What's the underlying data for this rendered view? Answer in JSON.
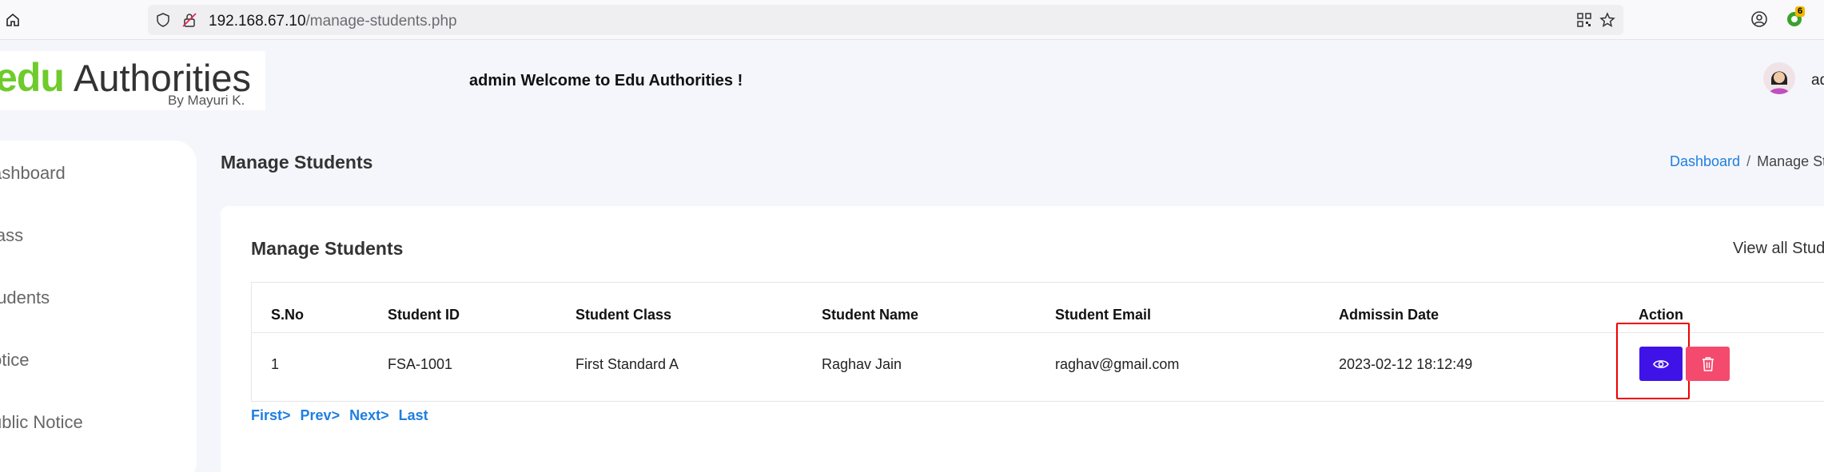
{
  "browser": {
    "url_host": "192.168.67.10",
    "url_path": "/manage-students.php",
    "extension_badge": "6"
  },
  "header": {
    "logo_main": "edu",
    "logo_rest": "Authorities",
    "logo_by": "By Mayuri K.",
    "welcome": "admin Welcome to Edu Authorities !",
    "user_name": "ad"
  },
  "sidebar": {
    "items": [
      {
        "label": "ashboard"
      },
      {
        "label": "lass"
      },
      {
        "label": "tudents"
      },
      {
        "label": "otice"
      },
      {
        "label": "ublic Notice"
      }
    ]
  },
  "page": {
    "title": "Manage Students",
    "breadcrumb_link": "Dashboard",
    "breadcrumb_sep": "/",
    "breadcrumb_current": "Manage St"
  },
  "card": {
    "title": "Manage Students",
    "view_all": "View all Stud"
  },
  "table": {
    "headers": [
      "S.No",
      "Student ID",
      "Student Class",
      "Student Name",
      "Student Email",
      "Admissin Date",
      "Action"
    ],
    "rows": [
      {
        "sno": "1",
        "student_id": "FSA-1001",
        "student_class": "First Standard A",
        "student_name": "Raghav Jain",
        "student_email": "raghav@gmail.com",
        "admission_date": "2023-02-12 18:12:49"
      }
    ]
  },
  "pagination": {
    "first": "First>",
    "prev": "Prev>",
    "next": "Next>",
    "last": "Last"
  },
  "colors": {
    "brand_green": "#6ecb2b",
    "link_blue": "#1f7ee0",
    "view_button": "#3f13e7",
    "delete_button": "#f44a6d",
    "highlight_red": "#f00000"
  },
  "icons": {
    "home": "home-icon",
    "shield": "shield-icon",
    "insecure": "insecure-lock-icon",
    "qr": "qr-code-icon",
    "bookmark": "star-icon",
    "account": "account-icon",
    "extension": "extension-icon",
    "view": "eye-icon",
    "delete": "trash-icon"
  }
}
